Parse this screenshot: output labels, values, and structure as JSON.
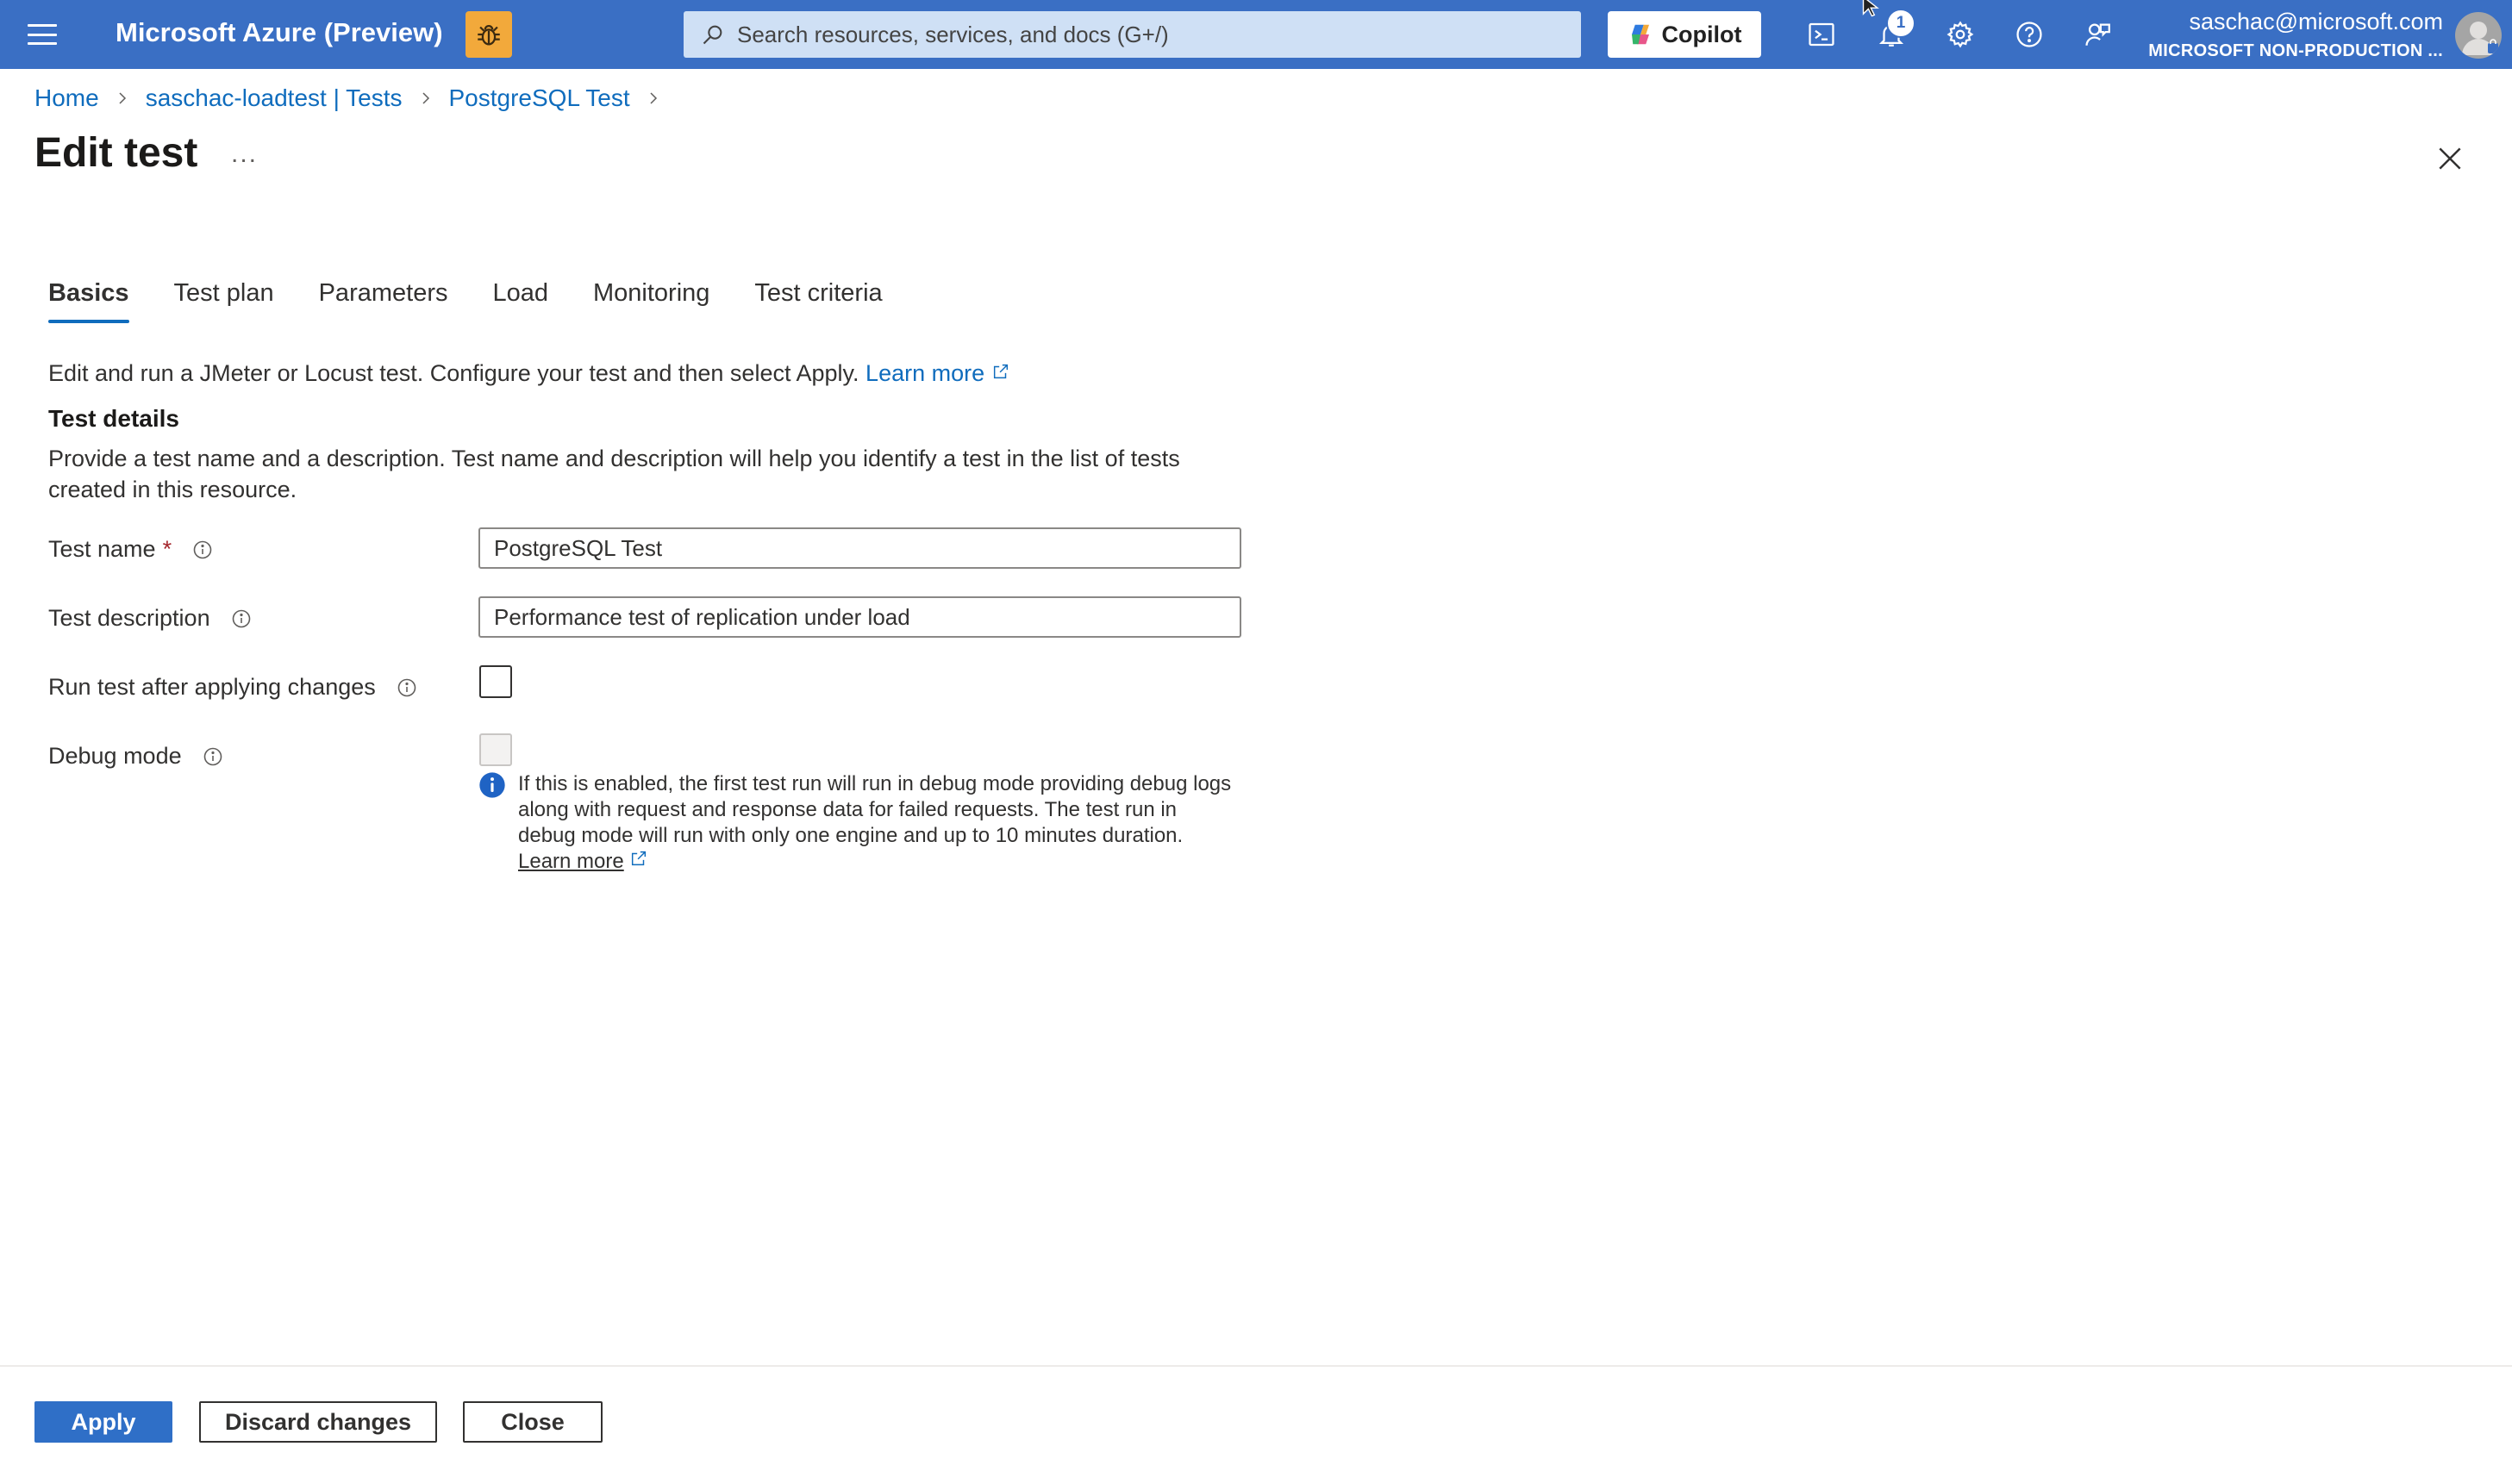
{
  "topbar": {
    "app_title": "Microsoft Azure (Preview)",
    "search_placeholder": "Search resources, services, and docs (G+/)",
    "copilot_label": "Copilot",
    "notification_count": "1",
    "user_email": "saschac@microsoft.com",
    "user_tenant": "MICROSOFT NON-PRODUCTION ...",
    "bar_color": "#3a6fc4"
  },
  "breadcrumb": {
    "items": [
      "Home",
      "saschac-loadtest | Tests",
      "PostgreSQL Test"
    ]
  },
  "page": {
    "title": "Edit test",
    "more_label": "..."
  },
  "tabs": [
    {
      "label": "Basics",
      "active": true
    },
    {
      "label": "Test plan"
    },
    {
      "label": "Parameters"
    },
    {
      "label": "Load"
    },
    {
      "label": "Monitoring"
    },
    {
      "label": "Test criteria"
    }
  ],
  "intro": {
    "text": "Edit and run a JMeter or Locust test. Configure your test and then select Apply.",
    "link": "Learn more"
  },
  "section": {
    "title": "Test details",
    "description": "Provide a test name and a description. Test name and description will help you identify a test in the list of tests created in this resource."
  },
  "form": {
    "test_name_label": "Test name",
    "required_mark": "*",
    "test_name_value": "PostgreSQL Test",
    "test_description_label": "Test description",
    "test_description_value": "Performance test of replication under load",
    "run_after_label": "Run test after applying changes",
    "run_after_checked": false,
    "debug_label": "Debug mode",
    "debug_checked": false,
    "debug_info": "If this is enabled, the first test run will run in debug mode providing debug logs along with request and response data for failed requests. The test run in debug mode will run with only one engine and up to 10 minutes duration.",
    "debug_link": "Learn more"
  },
  "footer": {
    "apply": "Apply",
    "discard": "Discard changes",
    "close": "Close"
  },
  "icons": {
    "menu": "hamburger-menu-icon",
    "bug": "bug-icon",
    "search": "search-icon",
    "terminal": "cloud-shell-icon",
    "bell": "bell-icon",
    "settings": "gear-icon",
    "help": "question-icon",
    "feedback": "feedback-icon",
    "info": "info-icon",
    "external": "external-link-icon",
    "close": "close-icon"
  }
}
